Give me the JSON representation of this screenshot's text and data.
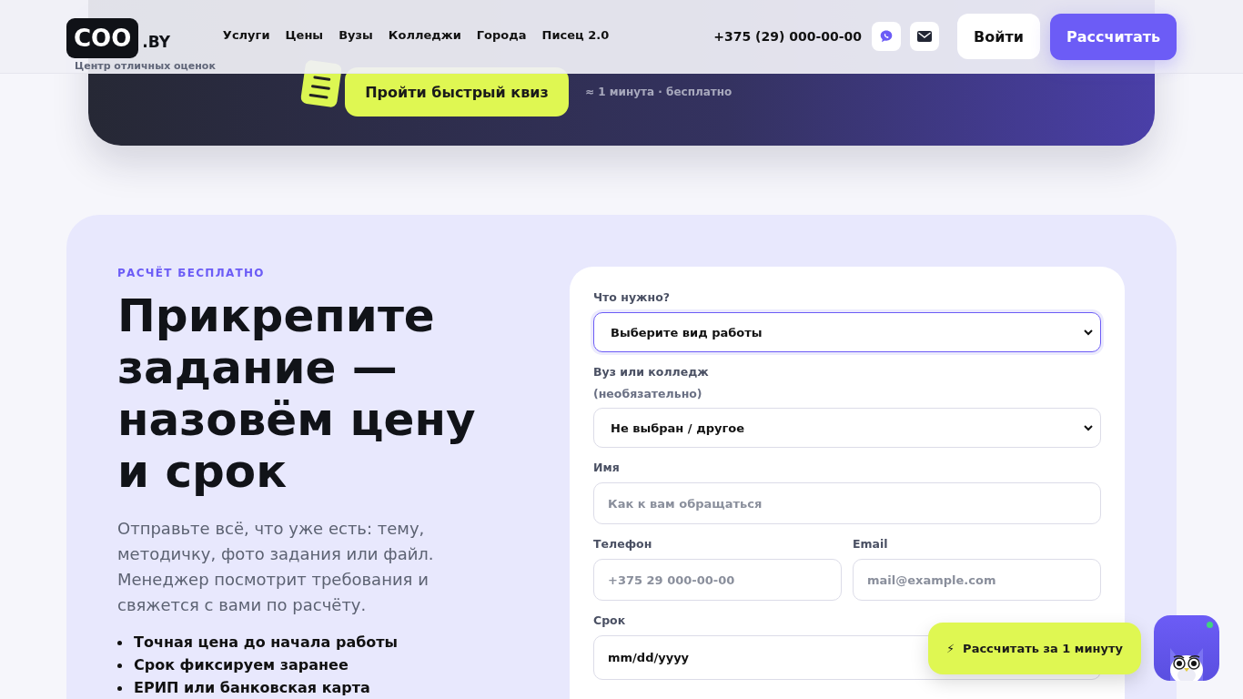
{
  "header": {
    "logo": {
      "mark": "COO",
      "suffix": ".BY",
      "tagline": "Центр отличных оценок"
    },
    "nav": [
      {
        "label": "Услуги"
      },
      {
        "label": "Цены"
      },
      {
        "label": "Вузы"
      },
      {
        "label": "Колледжи"
      },
      {
        "label": "Города"
      },
      {
        "label": "Писец 2.0"
      }
    ],
    "phone": "+375 (29) 000-00-00",
    "contacts": [
      {
        "kind": "viber"
      },
      {
        "kind": "mail"
      }
    ],
    "login": "Войти",
    "cta": "Рассчитать"
  },
  "banner": {
    "button": "Пройти быстрый квиз",
    "note": "≈ 1 минута · бесплатно"
  },
  "section": {
    "eyebrow": "РАСЧЁТ БЕСПЛАТНО",
    "title": "Прикрепите задание — назовём цену и срок",
    "text": "Отправьте всё, что уже есть: тему, методичку, фото задания или файл. Менеджер посмотрит требования и свяжется с вами по расчёту.",
    "bullets": [
      "Точная цена до начала работы",
      "Срок фиксируем заранее",
      "ЕРИП или банковская карта"
    ]
  },
  "form": {
    "fields": [
      {
        "kind": "select",
        "label": "Что нужно?",
        "value": "Выберите вид работы",
        "focused": true
      },
      {
        "kind": "select",
        "label": "Вуз или колледж",
        "sublabel": "(необязательно)",
        "value": "Не выбран / другое",
        "focused": false
      },
      {
        "kind": "input",
        "label": "Имя",
        "placeholder": "Как к вам обращаться",
        "focused": false
      },
      {
        "kind": "pair",
        "fields": [
          {
            "label": "Телефон",
            "placeholder": "+375 29 000-00-00",
            "focused": false
          },
          {
            "label": "Email",
            "placeholder": "mail@example.com",
            "focused": false
          }
        ]
      },
      {
        "kind": "date",
        "label": "Срок",
        "value": "mm/dd/yyyy",
        "focused": false
      }
    ]
  },
  "float_cta": {
    "icon": "⚡",
    "label": "Рассчитать за 1 минуту"
  }
}
